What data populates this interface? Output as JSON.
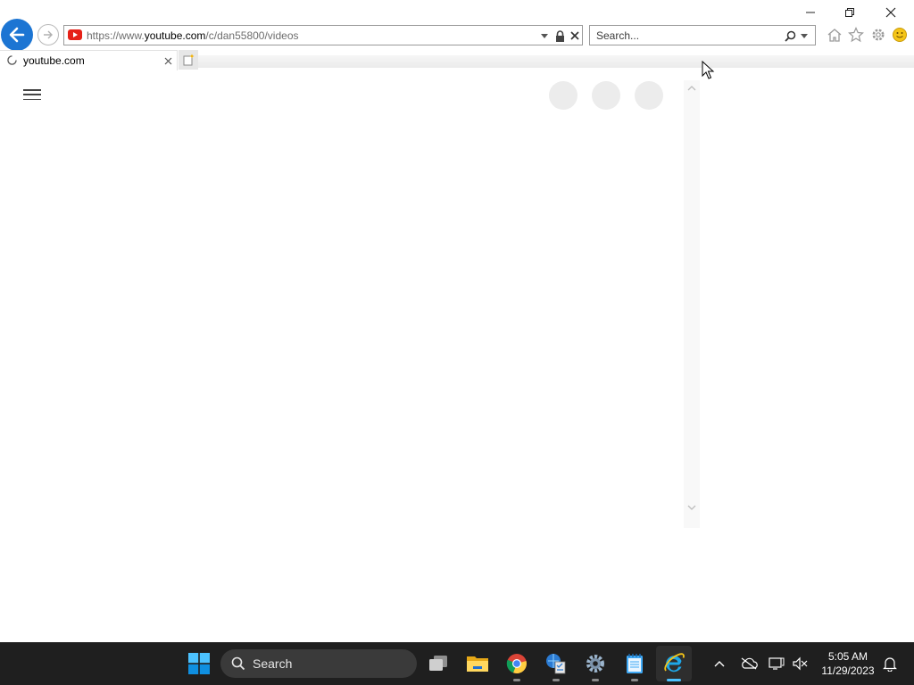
{
  "window": {
    "minimize_icon": "minimize-icon",
    "restore_icon": "restore-icon",
    "close_icon": "close-icon"
  },
  "navigation": {
    "back_icon": "back-arrow-icon",
    "forward_icon": "forward-arrow-icon"
  },
  "address_bar": {
    "site_icon": "youtube-icon",
    "url_prefix": "https://www.",
    "url_host": "youtube.com",
    "url_path": "/c/dan55800/videos"
  },
  "search_box": {
    "placeholder": "Search..."
  },
  "toolbar": {
    "icons": [
      "home-icon",
      "favorites-star-icon",
      "settings-gear-icon",
      "feedback-smiley-icon"
    ]
  },
  "tabs": [
    {
      "title": "youtube.com",
      "loading": true
    }
  ],
  "page": {
    "menu_icon": "hamburger-menu-icon",
    "placeholder_circles": 3
  },
  "taskbar": {
    "search_label": "Search",
    "apps": [
      "task-view",
      "file-explorer",
      "chrome",
      "task-manager",
      "settings",
      "notepad",
      "internet-explorer"
    ],
    "active_app": "internet-explorer",
    "clock": {
      "time": "5:05 AM",
      "date": "11/29/2023"
    }
  },
  "colors": {
    "accent_blue": "#1c75d3",
    "youtube_red": "#e62117",
    "taskbar_bg": "#1f1f1f",
    "active_indicator": "#4cc2ff"
  }
}
